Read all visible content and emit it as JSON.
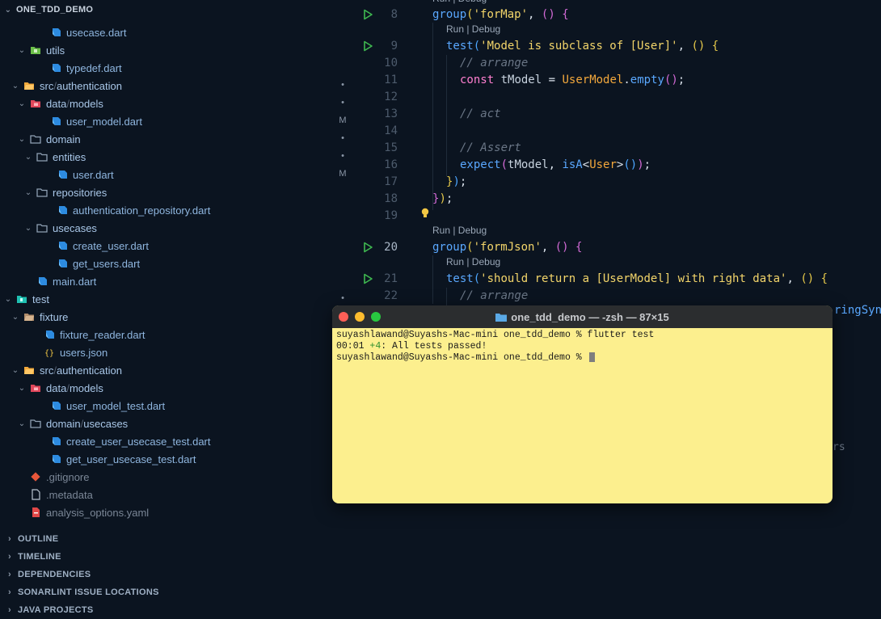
{
  "explorer": {
    "root_label": "ONE_TDD_DEMO",
    "rows": [
      {
        "label": "usecase.dart",
        "kind": "dart"
      },
      {
        "label": "utils",
        "kind": "folder-lib"
      },
      {
        "label": "typedef.dart",
        "kind": "dart"
      },
      {
        "label": "src",
        "label2": "authentication",
        "kind": "folder-src"
      },
      {
        "label": "data",
        "label2": "models",
        "kind": "folder-red"
      },
      {
        "label": "user_model.dart",
        "kind": "dart"
      },
      {
        "label": "domain",
        "kind": "folder"
      },
      {
        "label": "entities",
        "kind": "folder"
      },
      {
        "label": "user.dart",
        "kind": "dart"
      },
      {
        "label": "repositories",
        "kind": "folder"
      },
      {
        "label": "authentication_repository.dart",
        "kind": "dart"
      },
      {
        "label": "usecases",
        "kind": "folder"
      },
      {
        "label": "create_user.dart",
        "kind": "dart"
      },
      {
        "label": "get_users.dart",
        "kind": "dart"
      },
      {
        "label": "main.dart",
        "kind": "dart"
      },
      {
        "label": "test",
        "kind": "folder-test"
      },
      {
        "label": "fixture",
        "kind": "folder-fixture"
      },
      {
        "label": "fixture_reader.dart",
        "kind": "dart"
      },
      {
        "label": "users.json",
        "kind": "json"
      },
      {
        "label": "src",
        "label2": "authentication",
        "kind": "folder-src"
      },
      {
        "label": "data",
        "label2": "models",
        "kind": "folder-red"
      },
      {
        "label": "user_model_test.dart",
        "kind": "dart"
      },
      {
        "label": "domain",
        "label2": "usecases",
        "kind": "folder"
      },
      {
        "label": "create_user_usecase_test.dart",
        "kind": "dart"
      },
      {
        "label": "get_user_usecase_test.dart",
        "kind": "dart"
      },
      {
        "label": ".gitignore",
        "kind": "git"
      },
      {
        "label": ".metadata",
        "kind": "doc"
      },
      {
        "label": "analysis_options.yaml",
        "kind": "yaml"
      }
    ],
    "scm_marks": [
      "•",
      "•",
      "M",
      "•",
      "•",
      "M",
      "•"
    ],
    "panels": [
      "OUTLINE",
      "TIMELINE",
      "DEPENDENCIES",
      "SONARLINT ISSUE LOCATIONS",
      "JAVA PROJECTS"
    ]
  },
  "editor": {
    "codelens": "Run | Debug",
    "lines": {
      "l8": "8",
      "l9": "9",
      "l10": "10",
      "l11": "11",
      "l12": "12",
      "l13": "13",
      "l14": "14",
      "l15": "15",
      "l16": "16",
      "l17": "17",
      "l18": "18",
      "l19": "19",
      "l20": "20",
      "l21": "21",
      "l22": "22"
    },
    "code": {
      "group1_name": "'forMap'",
      "test1_name": "'Model is subclass of [User]'",
      "arrange": "// arrange",
      "act": "// act",
      "assert": "// Assert",
      "group2_name": "'formJson'",
      "test2_name": "'should return a [UserModel] with right data'",
      "arrange2": "// arrange"
    },
    "peek_fragments": {
      "right_text": "ringSync",
      "rs": "rs"
    }
  },
  "terminal": {
    "title": "one_tdd_demo — -zsh — 87×15",
    "line1": "suyashlawand@Suyashs-Mac-mini one_tdd_demo % flutter test",
    "line2_time": "00:01",
    "line2_count": "+4",
    "line2_msg": ": All tests passed!",
    "line3": "suyashlawand@Suyashs-Mac-mini one_tdd_demo % ",
    "colors": {
      "background": "#fcef8e",
      "close": "#ff5f57",
      "minimize": "#febc2e",
      "zoom": "#28c840"
    }
  }
}
